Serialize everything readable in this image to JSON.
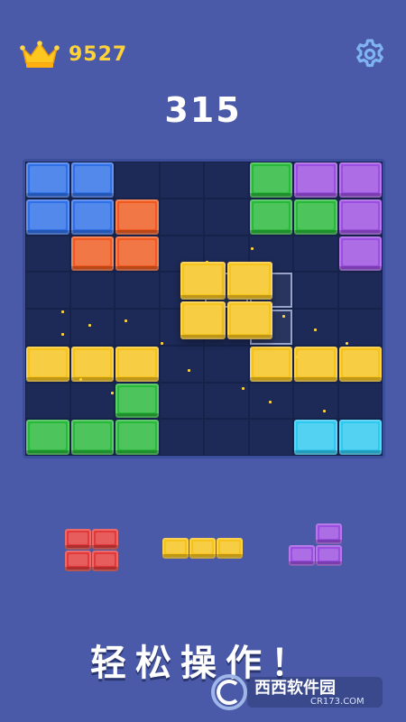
{
  "header": {
    "best_score": "9527",
    "crown_icon": "crown-icon",
    "settings_icon": "gear-icon"
  },
  "score": "315",
  "colors": {
    "background": "#4a5aa8",
    "board": "#1d2956",
    "blue": "#2f6fe8",
    "green": "#28b83a",
    "purple": "#9b4fe0",
    "orange": "#f05a1e",
    "yellow": "#f6c21c",
    "cyan": "#2ec8f0",
    "red": "#e23a3a",
    "crown": "#ffc820"
  },
  "board": {
    "cols": 8,
    "rows": 8,
    "cells": [
      [
        "blue",
        "blue",
        "",
        "",
        "",
        "green",
        "purple",
        "purple"
      ],
      [
        "blue",
        "blue",
        "orange",
        "",
        "",
        "green",
        "green",
        "purple"
      ],
      [
        "",
        "orange",
        "orange",
        "",
        "",
        "",
        "",
        "purple"
      ],
      [
        "",
        "",
        "",
        "",
        "",
        "",
        "",
        ""
      ],
      [
        "",
        "",
        "",
        "",
        "",
        "",
        "",
        ""
      ],
      [
        "yellow",
        "yellow",
        "yellow",
        "",
        "",
        "yellow",
        "yellow",
        "yellow"
      ],
      [
        "",
        "",
        "green",
        "",
        "",
        "",
        "",
        ""
      ],
      [
        "green",
        "green",
        "green",
        "",
        "",
        "",
        "cyan",
        "cyan"
      ]
    ],
    "ghost_cells": [
      [
        4,
        3
      ],
      [
        5,
        3
      ],
      [
        5,
        4
      ]
    ],
    "dragging_piece": {
      "color": "yellow",
      "cells": [
        [
          0,
          0
        ],
        [
          1,
          0
        ],
        [
          0,
          1
        ],
        [
          1,
          1
        ]
      ]
    }
  },
  "tray": [
    {
      "name": "red-square-piece",
      "color": "red",
      "cells": [
        [
          0,
          0
        ],
        [
          1,
          0
        ],
        [
          0,
          1
        ],
        [
          1,
          1
        ]
      ]
    },
    {
      "name": "yellow-line-piece",
      "color": "yellow",
      "cells": [
        [
          0,
          0
        ],
        [
          1,
          0
        ],
        [
          2,
          0
        ]
      ]
    },
    {
      "name": "purple-corner-piece",
      "color": "purple",
      "cells": [
        [
          1,
          0
        ],
        [
          0,
          1
        ],
        [
          1,
          1
        ]
      ]
    }
  ],
  "banner_text": "轻松操作！",
  "watermark": {
    "brand": "西西软件园",
    "url": "CR173.COM"
  }
}
